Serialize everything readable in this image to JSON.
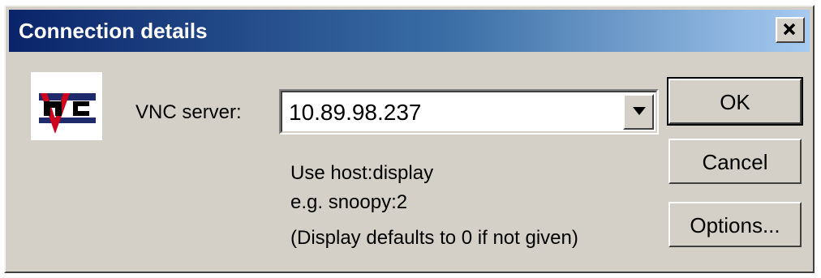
{
  "window": {
    "title": "Connection details"
  },
  "icons": {
    "logo": "vnc-logo-icon",
    "close": "close-icon",
    "dropdown": "chevron-down-icon"
  },
  "colors": {
    "titlebar_start": "#0a246a",
    "titlebar_end": "#a6caf0",
    "dialog_bg": "#d4d0c8",
    "logo_red": "#d0021b",
    "logo_navy": "#1f2a6b"
  },
  "form": {
    "server_label": "VNC server:",
    "server_value": "10.89.98.237",
    "hint_line1": "Use host:display",
    "hint_line2": "e.g. snoopy:2",
    "hint_line3": "(Display defaults to 0 if not given)"
  },
  "buttons": {
    "ok": "OK",
    "cancel": "Cancel",
    "options": "Options..."
  }
}
